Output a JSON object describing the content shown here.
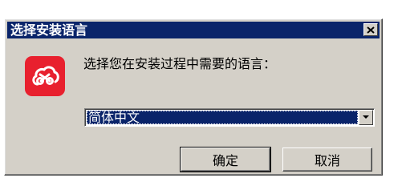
{
  "window": {
    "title": "选择安装语言",
    "close_icon": "close-icon"
  },
  "app_icon": "cloud-logo-icon",
  "colors": {
    "titlebar": "#0a246a",
    "dialog_bg": "#d4d0c8",
    "icon_bg": "#e8202e",
    "selection": "#0a246a"
  },
  "prompt": {
    "text": "选择您在安装过程中需要的语言："
  },
  "language_select": {
    "selected": "简体中文",
    "arrow_icon": "dropdown-arrow-icon"
  },
  "buttons": {
    "ok_label": "确定",
    "cancel_label": "取消"
  }
}
